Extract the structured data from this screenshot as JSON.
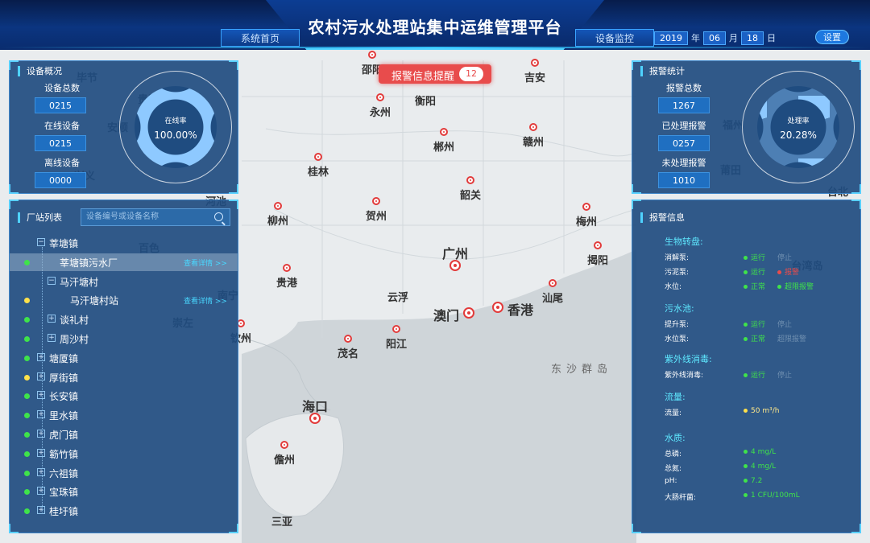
{
  "header": {
    "title": "农村污水处理站集中运维管理平台",
    "nav_home": "系统首页",
    "nav_monitor": "设备监控",
    "date_year": "2019",
    "date_sep_year": "年",
    "date_month": "06",
    "date_sep_month": "月",
    "date_day": "18",
    "date_sep_day": "日",
    "settings_label": "设置"
  },
  "alarm_reminder": {
    "label": "报警信息提醒",
    "count": "12"
  },
  "device_overview": {
    "title": "设备概况",
    "total_label": "设备总数",
    "total_value": "0215",
    "online_label": "在线设备",
    "online_value": "0215",
    "offline_label": "离线设备",
    "offline_value": "0000",
    "ring_label": "在线率",
    "ring_value": "100.00%",
    "ring_fraction": 1.0
  },
  "alarm_stats": {
    "title": "报警统计",
    "total_label": "报警总数",
    "total_value": "1267",
    "handled_label": "已处理报警",
    "handled_value": "0257",
    "unhandled_label": "未处理报警",
    "unhandled_value": "1010",
    "ring_label": "处理率",
    "ring_value": "20.28%",
    "ring_fraction": 0.2028
  },
  "station_list": {
    "title": "厂站列表",
    "search_placeholder": "设备编号或设备名称",
    "detail_link": "查看详情 >>",
    "items": [
      {
        "label": "莘塘镇",
        "status": ""
      },
      {
        "label": "莘塘镇污水厂",
        "status": "green"
      },
      {
        "label": "马汗塘村",
        "status": ""
      },
      {
        "label": "马汗塘村站",
        "status": "yellow"
      },
      {
        "label": "谈礼村",
        "status": "green"
      },
      {
        "label": "周沙村",
        "status": "green"
      },
      {
        "label": "塘厦镇",
        "status": "green"
      },
      {
        "label": "厚街镇",
        "status": "yellow"
      },
      {
        "label": "长安镇",
        "status": "green"
      },
      {
        "label": "里水镇",
        "status": "green"
      },
      {
        "label": "虎门镇",
        "status": "green"
      },
      {
        "label": "簕竹镇",
        "status": "green"
      },
      {
        "label": "六祖镇",
        "status": "green"
      },
      {
        "label": "宝珠镇",
        "status": "green"
      },
      {
        "label": "桂圩镇",
        "status": "green"
      }
    ]
  },
  "alarm_info": {
    "title": "报警信息",
    "sections": [
      {
        "title": "生物转盘:",
        "rows": [
          {
            "label": "消解泵:",
            "s1": "运行",
            "s2": "停止"
          },
          {
            "label": "污泥泵:",
            "s1": "运行",
            "s2": "报警"
          },
          {
            "label": "水位:",
            "s1": "正常",
            "s2": "超限报警"
          }
        ]
      },
      {
        "title": "污水池:",
        "rows": [
          {
            "label": "提升泵:",
            "s1": "运行",
            "s2": "停止"
          },
          {
            "label": "水位泵:",
            "s1": "正常",
            "s2": "超限报警"
          }
        ]
      },
      {
        "title": "紫外线消毒:",
        "rows": [
          {
            "label": "紫外线消毒:",
            "s1": "运行",
            "s2": "停止"
          }
        ]
      },
      {
        "title": "流量:",
        "rows": [
          {
            "label": "流量:",
            "s1": "50 m³/h",
            "s2": ""
          }
        ]
      },
      {
        "title": "水质:",
        "rows": [
          {
            "label": "总磷:",
            "s1": "4 mg/L",
            "s2": ""
          },
          {
            "label": "总氮:",
            "s1": "4 mg/L",
            "s2": ""
          },
          {
            "label": "pH:",
            "s1": "7.2",
            "s2": ""
          },
          {
            "label": "大肠杆菌:",
            "s1": "1 CFU/100mL",
            "s2": ""
          }
        ]
      }
    ]
  },
  "map": {
    "cities": [
      "邵阳",
      "衡阳",
      "吉安",
      "永州",
      "郴州",
      "赣州",
      "桂林",
      "韶关",
      "贺州",
      "柳州",
      "梅州",
      "揭阳",
      "广州",
      "贵港",
      "云浮",
      "汕尾",
      "澳门",
      "香港",
      "茂名",
      "阳江",
      "海口",
      "儋州",
      "三亚",
      "钦州",
      "百色",
      "南宁",
      "贵阳",
      "安顺",
      "崇左",
      "台北",
      "台湾岛",
      "莆田",
      "福州",
      "毕节",
      "兴义",
      "河池"
    ],
    "sea_label": "东沙群岛"
  },
  "colors": {
    "accent": "#4fd2ff",
    "alarm": "#e84c4c",
    "ok": "#3fe34a",
    "warn": "#ffe14a",
    "panel": "#1f4c80"
  }
}
